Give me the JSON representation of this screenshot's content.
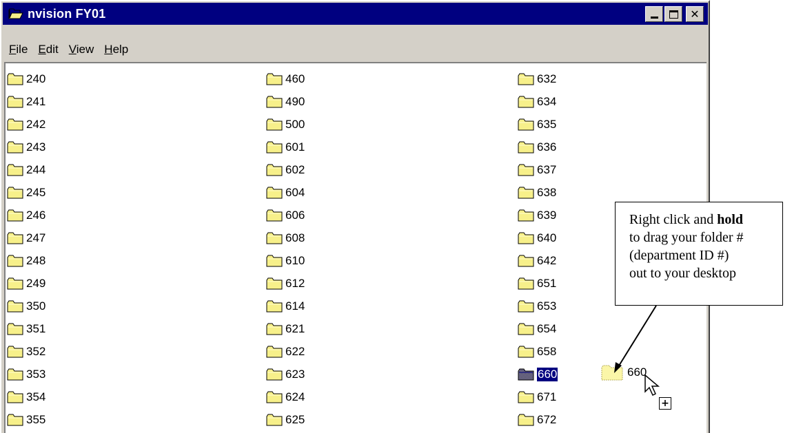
{
  "window": {
    "title": "nvision FY01",
    "icon": "folder-open-icon",
    "controls": [
      "minimize-icon",
      "maximize-icon",
      "close-icon"
    ],
    "close_glyph": "✕"
  },
  "menu": [
    {
      "name": "file",
      "pre": "",
      "key": "F",
      "post": "ile"
    },
    {
      "name": "edit",
      "pre": "",
      "key": "E",
      "post": "dit"
    },
    {
      "name": "view",
      "pre": "",
      "key": "V",
      "post": "iew"
    },
    {
      "name": "help",
      "pre": "",
      "key": "H",
      "post": "elp"
    }
  ],
  "folders": {
    "column1": [
      "240",
      "241",
      "242",
      "243",
      "244",
      "245",
      "246",
      "247",
      "248",
      "249",
      "350",
      "351",
      "352",
      "353",
      "354",
      "355"
    ],
    "column2": [
      "460",
      "490",
      "500",
      "601",
      "602",
      "604",
      "606",
      "608",
      "610",
      "612",
      "614",
      "621",
      "622",
      "623",
      "624",
      "625"
    ],
    "column3": [
      "632",
      "634",
      "635",
      "636",
      "637",
      "638",
      "639",
      "640",
      "642",
      "651",
      "653",
      "654",
      "658",
      "660",
      "671",
      "672"
    ],
    "selected": "660"
  },
  "callout": {
    "line1_pre": "Right click and ",
    "line1_bold": "hold",
    "line2": "to drag your folder #",
    "line3": "(department ID #)",
    "line4": "out to your desktop"
  },
  "drag_ghost": {
    "label": "660",
    "plus": "+"
  },
  "colors": {
    "titlebar": "#000080",
    "chrome": "#d4d0c8",
    "folder": "#f7f08a",
    "selection": "#000080"
  }
}
